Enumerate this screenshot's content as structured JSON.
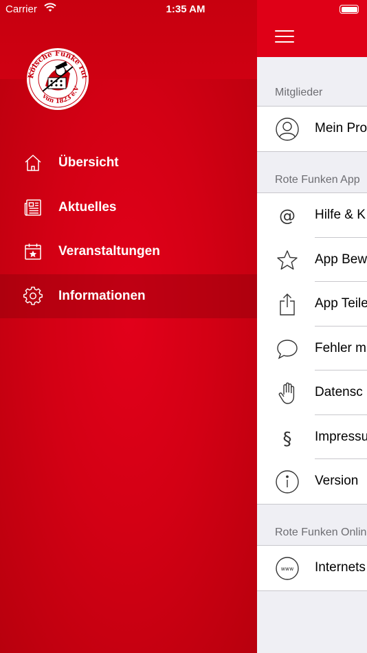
{
  "status_bar": {
    "carrier": "Carrier",
    "time": "1:35 AM"
  },
  "drawer": {
    "items": [
      {
        "label": "Übersicht",
        "icon": "home-icon"
      },
      {
        "label": "Aktuelles",
        "icon": "newspaper-icon"
      },
      {
        "label": "Veranstaltungen",
        "icon": "calendar-star-icon"
      },
      {
        "label": "Informationen",
        "icon": "gear-icon",
        "active": true
      }
    ],
    "logo": {
      "top_text": "Kölsche Funke rut-wieß",
      "bottom_text": "vun 1823 e.V."
    }
  },
  "panel": {
    "sections": [
      {
        "header": "Mitglieder",
        "rows": [
          {
            "label": "Mein Pro",
            "icon": "person-circle-icon"
          }
        ]
      },
      {
        "header": "Rote Funken App",
        "rows": [
          {
            "label": "Hilfe & K",
            "icon": "at-sign-icon"
          },
          {
            "label": "App Bew",
            "icon": "star-icon"
          },
          {
            "label": "App Teile",
            "icon": "share-icon"
          },
          {
            "label": "Fehler m",
            "icon": "speech-bubble-icon"
          },
          {
            "label": "Datensc",
            "icon": "hand-icon"
          },
          {
            "label": "Impressu",
            "icon": "paragraph-icon"
          },
          {
            "label": "Version",
            "icon": "info-icon"
          }
        ]
      },
      {
        "header": "Rote Funken Onlin",
        "rows": [
          {
            "label": "Internets",
            "icon": "www-globe-icon"
          }
        ]
      }
    ]
  },
  "colors": {
    "brand_red": "#e2001a",
    "panel_bg": "#efeff4",
    "separator": "#c8c7cc"
  }
}
